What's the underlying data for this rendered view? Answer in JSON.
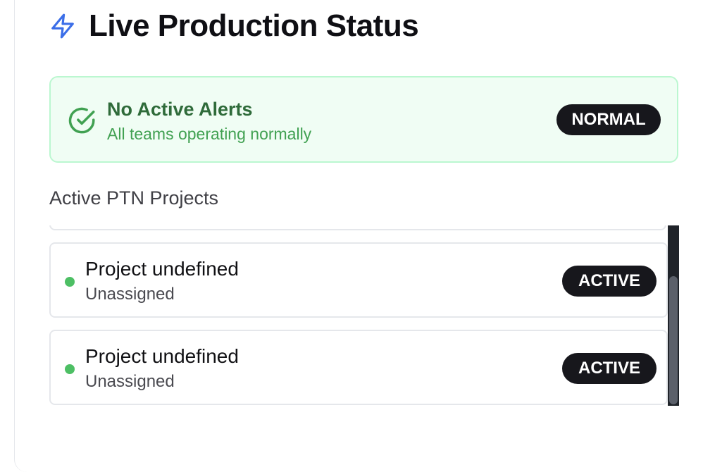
{
  "header": {
    "title": "Live Production Status",
    "icon": "bolt-icon"
  },
  "alert": {
    "title": "No Active Alerts",
    "subtitle": "All teams operating normally",
    "badge": "NORMAL",
    "icon": "check-circle-icon"
  },
  "projects": {
    "section_title": "Active PTN Projects",
    "items": [
      {
        "name": "Project undefined",
        "owner": "Unassigned",
        "status": "ACTIVE"
      },
      {
        "name": "Project undefined",
        "owner": "Unassigned",
        "status": "ACTIVE"
      }
    ]
  },
  "colors": {
    "accent_blue": "#3b6ee8",
    "success_green": "#41a152",
    "badge_dark": "#17171c"
  }
}
